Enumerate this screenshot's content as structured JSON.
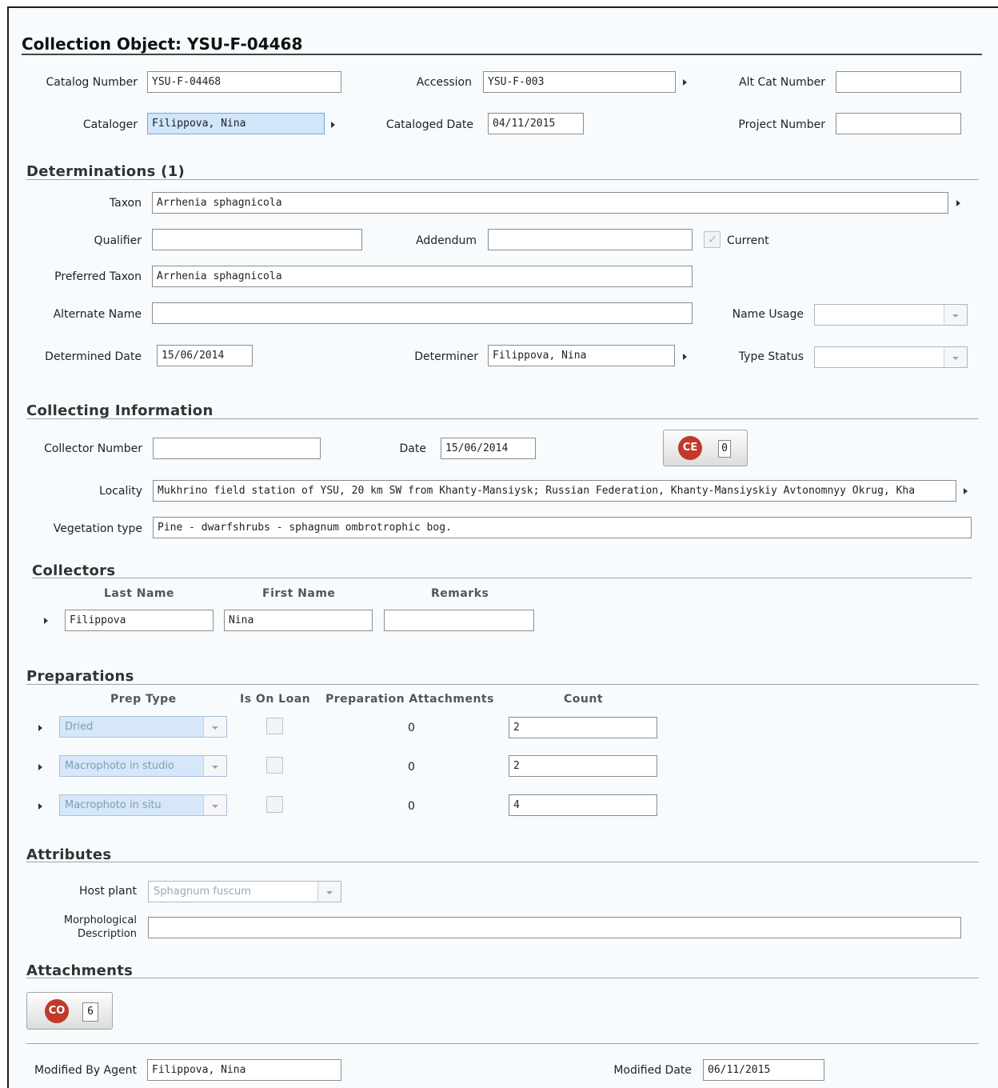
{
  "header": {
    "title": "Collection Object: YSU-F-04468"
  },
  "catalog": {
    "catalog_number_label": "Catalog Number",
    "catalog_number": "YSU-F-04468",
    "accession_label": "Accession",
    "accession": "YSU-F-003",
    "alt_cat_label": "Alt Cat Number",
    "alt_cat": "",
    "cataloger_label": "Cataloger",
    "cataloger": "Filippova, Nina",
    "cataloged_date_label": "Cataloged Date",
    "cataloged_date": "04/11/2015",
    "project_number_label": "Project Number",
    "project_number": ""
  },
  "determinations": {
    "title": "Determinations (1)",
    "taxon_label": "Taxon",
    "taxon": "Arrhenia sphagnicola",
    "qualifier_label": "Qualifier",
    "qualifier": "",
    "addendum_label": "Addendum",
    "addendum": "",
    "current_label": "Current",
    "current_checked": true,
    "preferred_taxon_label": "Preferred Taxon",
    "preferred_taxon": "Arrhenia sphagnicola",
    "alternate_name_label": "Alternate Name",
    "alternate_name": "",
    "name_usage_label": "Name Usage",
    "name_usage": "",
    "determined_date_label": "Determined Date",
    "determined_date": "15/06/2014",
    "determiner_label": "Determiner",
    "determiner": "Filippova, Nina",
    "type_status_label": "Type Status",
    "type_status": ""
  },
  "collecting": {
    "title": "Collecting Information",
    "collector_number_label": "Collector Number",
    "collector_number": "",
    "date_label": "Date",
    "date": "15/06/2014",
    "ce_button_icon": "ce-icon",
    "ce_count": "0",
    "locality_label": "Locality",
    "locality": "Mukhrino field station of YSU, 20 km SW from Khanty-Mansiysk; Russian Federation, Khanty-Mansiyskiy Avtonomnyy Okrug, Kha",
    "vegetation_label": "Vegetation type",
    "vegetation": "Pine - dwarfshrubs - sphagnum ombrotrophic bog."
  },
  "collectors": {
    "title": "Collectors",
    "columns": [
      "Last Name",
      "First Name",
      "Remarks"
    ],
    "rows": [
      {
        "last": "Filippova",
        "first": "Nina",
        "remarks": ""
      }
    ]
  },
  "preparations": {
    "title": "Preparations",
    "columns": [
      "Prep Type",
      "Is On Loan",
      "Preparation Attachments",
      "Count"
    ],
    "rows": [
      {
        "prep_type": "Dried",
        "attachments": "0",
        "count": "2"
      },
      {
        "prep_type": "Macrophoto in studio",
        "attachments": "0",
        "count": "2"
      },
      {
        "prep_type": "Macrophoto in situ",
        "attachments": "0",
        "count": "4"
      }
    ]
  },
  "attributes": {
    "title": "Attributes",
    "host_plant_label": "Host plant",
    "host_plant": "Sphagnum fuscum",
    "morph_label_1": "Morphological",
    "morph_label_2": "Description",
    "morph": ""
  },
  "attachments": {
    "title": "Attachments",
    "button_icon": "co-icon",
    "count": "6"
  },
  "footer": {
    "modified_by_label": "Modified By Agent",
    "modified_by": "Filippova, Nina",
    "modified_date_label": "Modified Date",
    "modified_date": "06/11/2015"
  },
  "colors": {
    "selected_field": "#cfe6fb",
    "badge": "#c0392b",
    "background": "#f7fbfe"
  }
}
